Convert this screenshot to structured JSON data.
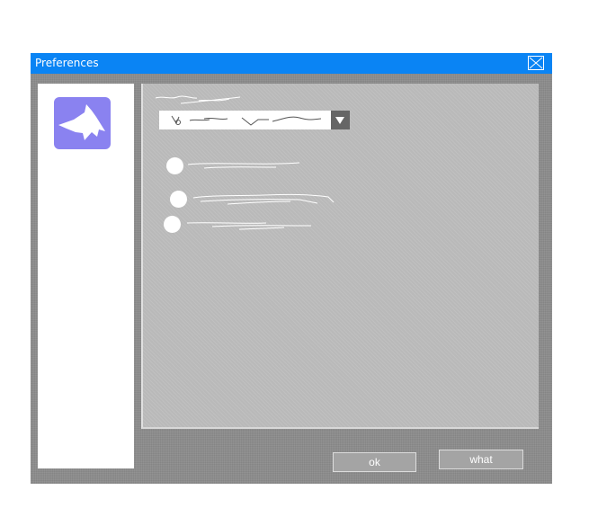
{
  "window": {
    "title": "Preferences"
  },
  "icons": {
    "close": "close-icon",
    "logo": "shark-logo-icon",
    "dropdown_arrow": "chevron-down-icon"
  },
  "colors": {
    "titlebar": "#0a84f4",
    "logo_background": "#8a82f0",
    "window_background": "#8c8c8c",
    "panel_background": "#b9b9b9"
  },
  "buttons": {
    "ok_label": "ok",
    "what_label": "what"
  }
}
